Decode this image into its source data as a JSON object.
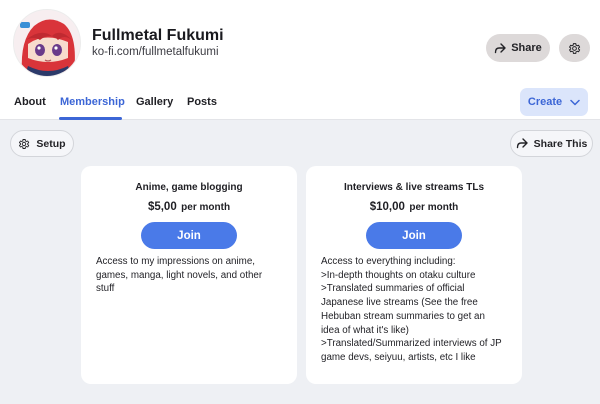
{
  "profile": {
    "name": "Fullmetal Fukumi",
    "url": "ko-fi.com/fullmetalfukumi"
  },
  "header": {
    "share_label": "Share",
    "share_icon": "share-arrow-icon",
    "settings_icon": "gear-icon"
  },
  "tabs": [
    {
      "label": "About",
      "active": false
    },
    {
      "label": "Membership",
      "active": true
    },
    {
      "label": "Gallery",
      "active": false
    },
    {
      "label": "Posts",
      "active": false
    }
  ],
  "create": {
    "label": "Create",
    "icon": "chevron-down-icon"
  },
  "setup": {
    "label": "Setup",
    "icon": "gear-icon"
  },
  "share_this": {
    "label": "Share This",
    "icon": "share-arrow-icon"
  },
  "tiers": [
    {
      "title": "Anime, game blogging",
      "price": "$5,00",
      "period": "per month",
      "join_label": "Join",
      "description_lines": [
        "Access to my impressions on anime,",
        "games, manga, light novels, and other",
        "stuff"
      ]
    },
    {
      "title": "Interviews & live streams TLs",
      "price": "$10,00",
      "period": "per month",
      "join_label": "Join",
      "description_lines": [
        "Access to everything including:",
        ">In-depth thoughts on otaku culture",
        ">Translated summaries of official",
        "Japanese live streams (See the free",
        "Hebuban stream summaries to get an",
        "idea of what it's like)",
        ">Translated/Summarized interviews of JP",
        "game devs, seiyuu, artists, etc I like"
      ]
    }
  ],
  "colors": {
    "accent": "#3c66d6",
    "join_button": "#4a7ae8",
    "page_background": "#eef0f4"
  }
}
